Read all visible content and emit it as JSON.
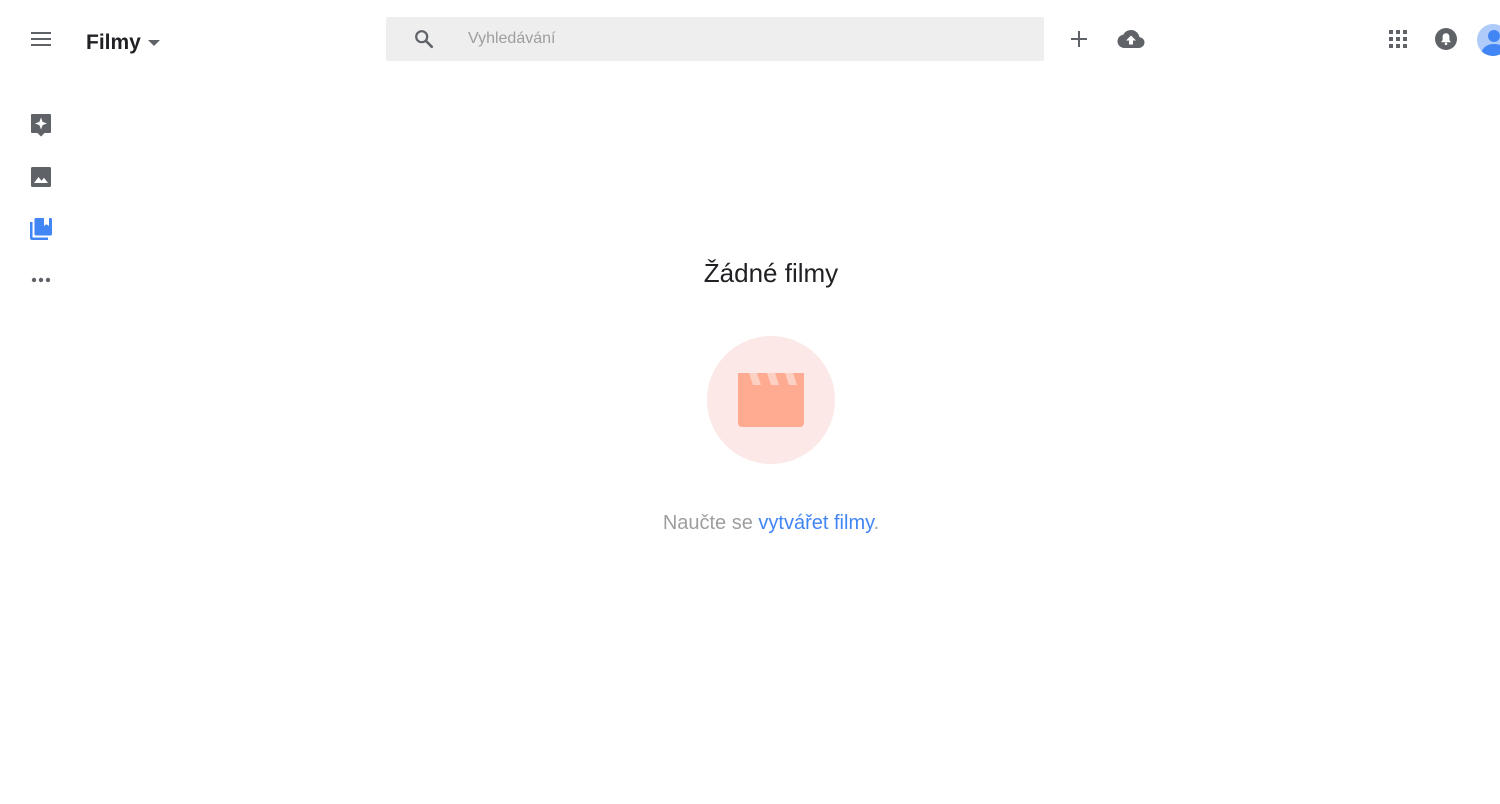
{
  "header": {
    "title": "Filmy",
    "search_placeholder": "Vyhledávání"
  },
  "icons": {
    "menu": "menu-icon",
    "dropdown": "caret-down-icon",
    "search": "search-icon",
    "create": "plus-icon",
    "upload": "cloud-upload-icon",
    "apps": "apps-grid-icon",
    "notifications": "bell-icon",
    "account": "avatar"
  },
  "sidebar": {
    "items": [
      {
        "name": "assistant",
        "icon": "assistant-icon",
        "active": false
      },
      {
        "name": "photos",
        "icon": "photo-icon",
        "active": false
      },
      {
        "name": "albums",
        "icon": "albums-icon",
        "active": true
      },
      {
        "name": "more",
        "icon": "more-horizontal-icon",
        "active": false
      }
    ]
  },
  "empty_state": {
    "title": "Žádné filmy",
    "hint_prefix": "Naučte se ",
    "hint_link": "vytvářet filmy",
    "hint_suffix": ".",
    "illustration": "clapperboard-icon"
  },
  "colors": {
    "accent": "#4285f4",
    "icon_gray": "#5f6368",
    "search_bg": "#eeeeee",
    "illustration_bg": "#fce8e6",
    "illustration_fg": "#ffab91"
  }
}
